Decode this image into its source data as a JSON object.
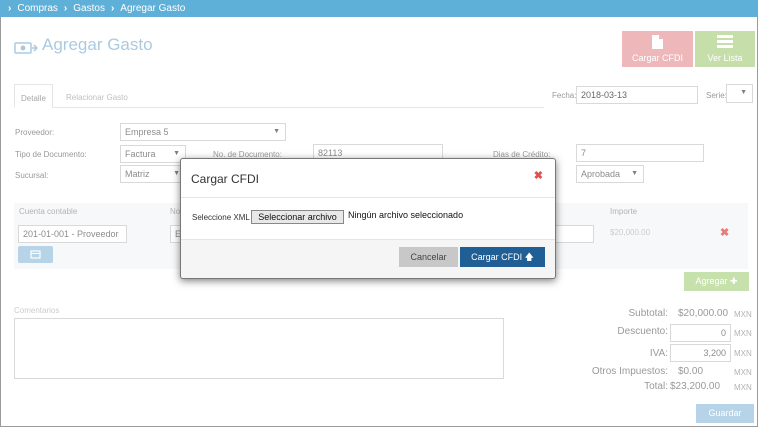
{
  "breadcrumb": {
    "items": [
      "Compras",
      "Gastos",
      "Agregar Gasto"
    ]
  },
  "page": {
    "title": "Agregar Gasto"
  },
  "toolbar": {
    "cargar_cfdi": "Cargar CFDI",
    "ver_lista": "Ver Lista"
  },
  "tabs": [
    {
      "label": "Detalle"
    },
    {
      "label": "Relacionar Gasto"
    }
  ],
  "header": {
    "fecha_label": "Fecha:",
    "fecha_value": "2018-03-13",
    "serie_label": "Serie:"
  },
  "form": {
    "proveedor_label": "Proveedor:",
    "proveedor_value": "Empresa 5",
    "tipo_label": "Tipo de Documento:",
    "tipo_value": "Factura",
    "no_doc_label": "No. de Documento:",
    "no_doc_value": "82113",
    "dias_label": "Dias de Crédito:",
    "dias_value": "7",
    "sucursal_label": "Sucursal:",
    "sucursal_value": "Matriz",
    "estado_value": "Aprobada"
  },
  "lines": {
    "col_cuenta": "Cuenta contable",
    "col_no": "No",
    "col_importe": "Importe",
    "cuenta_value": "201-01-001 - Proveedor",
    "partial_value": "E",
    "importe_value": "$20,000.00",
    "agregar_label": "Agregar"
  },
  "comments": {
    "label": "Comentarios"
  },
  "totals": {
    "subtotal_label": "Subtotal:",
    "subtotal_value": "$20,000.00",
    "descuento_label": "Descuento:",
    "descuento_value": "0",
    "iva_label": "IVA:",
    "iva_value": "3,200",
    "otros_label": "Otros Impuestos:",
    "otros_value": "$0.00",
    "total_label": "Total:",
    "total_value": "$23,200.00",
    "currency": "MXN"
  },
  "guardar_label": "Guardar",
  "modal": {
    "title": "Cargar CFDI",
    "xml_label": "Seleccione XML",
    "file_button": "Seleccionar archivo",
    "file_status": "Ningún archivo seleccionado",
    "cancel_label": "Cancelar",
    "submit_label": "Cargar CFDI"
  }
}
